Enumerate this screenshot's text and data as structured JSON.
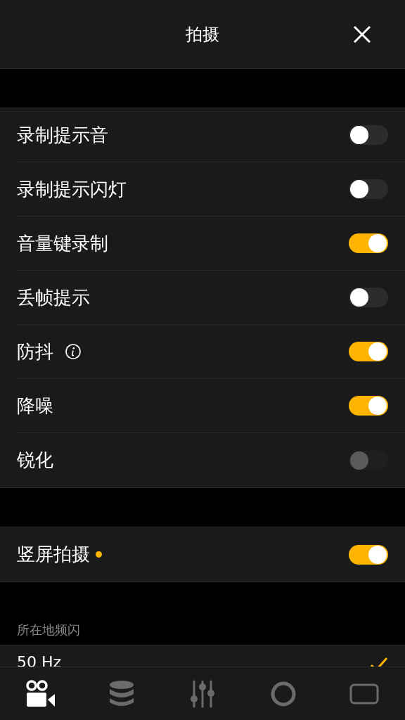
{
  "header": {
    "title": "拍摄"
  },
  "groups": [
    {
      "items": [
        {
          "label": "录制提示音",
          "on": false,
          "disabled": false,
          "info": false,
          "new_dot": false
        },
        {
          "label": "录制提示闪灯",
          "on": false,
          "disabled": false,
          "info": false,
          "new_dot": false
        },
        {
          "label": "音量键录制",
          "on": true,
          "disabled": false,
          "info": false,
          "new_dot": false
        },
        {
          "label": "丢帧提示",
          "on": false,
          "disabled": false,
          "info": false,
          "new_dot": false
        },
        {
          "label": "防抖",
          "on": true,
          "disabled": false,
          "info": true,
          "new_dot": false
        },
        {
          "label": "降噪",
          "on": true,
          "disabled": false,
          "info": false,
          "new_dot": false
        },
        {
          "label": "锐化",
          "on": false,
          "disabled": true,
          "info": false,
          "new_dot": false
        }
      ]
    },
    {
      "items": [
        {
          "label": "竖屏拍摄",
          "on": true,
          "disabled": false,
          "info": false,
          "new_dot": true
        }
      ]
    }
  ],
  "flicker": {
    "heading": "所在地频闪",
    "options": [
      {
        "label": "50 Hz",
        "selected": true
      }
    ]
  },
  "tab_bar": [
    {
      "kind": "camera",
      "selected": true
    },
    {
      "kind": "storage",
      "selected": false
    },
    {
      "kind": "sliders",
      "selected": false
    },
    {
      "kind": "circle",
      "selected": false
    },
    {
      "kind": "frame",
      "selected": false
    }
  ]
}
